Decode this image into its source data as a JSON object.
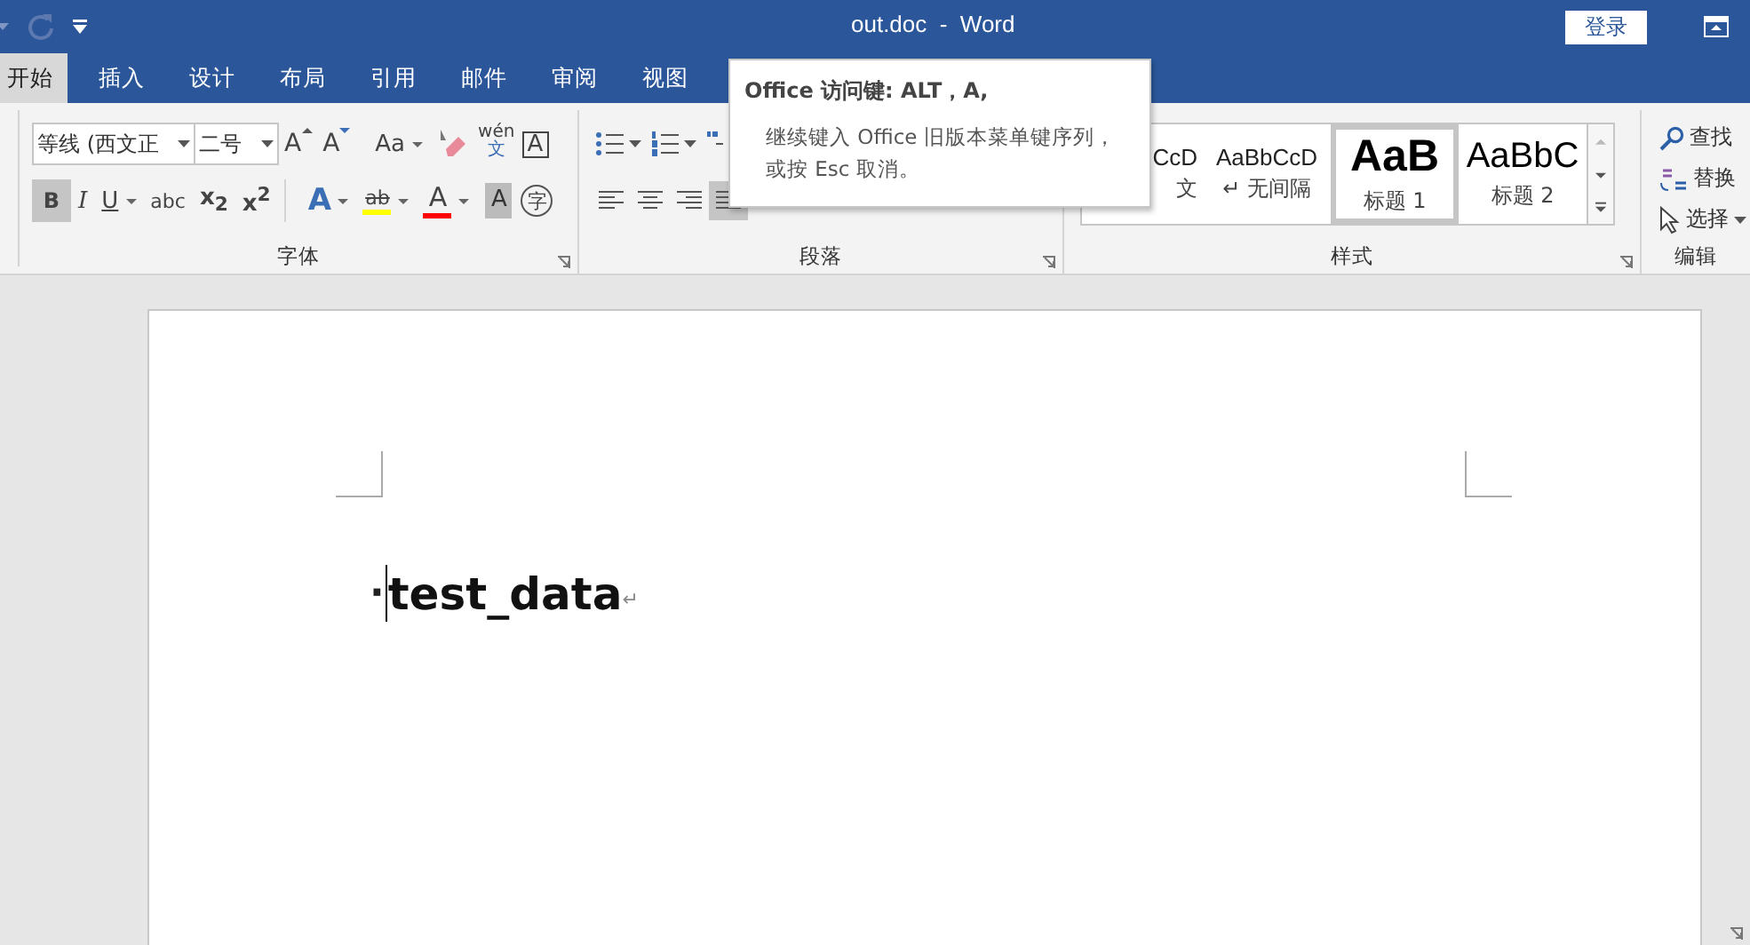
{
  "title_bar": {
    "redo": {
      "disabled": true
    },
    "title": "out.doc  -  Word",
    "login": "登录"
  },
  "tabs": [
    {
      "label": "开始",
      "selected": true
    },
    {
      "label": "插入",
      "selected": false
    },
    {
      "label": "设计",
      "selected": false
    },
    {
      "label": "布局",
      "selected": false
    },
    {
      "label": "引用",
      "selected": false
    },
    {
      "label": "邮件",
      "selected": false
    },
    {
      "label": "审阅",
      "selected": false
    },
    {
      "label": "视图",
      "selected": false
    }
  ],
  "font_group": {
    "label": "字体",
    "font": "等线 (西文正",
    "size": "二号",
    "row1": [
      {
        "kind": "grow",
        "text": "A"
      },
      {
        "kind": "shrink",
        "text": "A"
      },
      {
        "kind": "case",
        "text": "Aa"
      },
      {
        "kind": "eraser"
      },
      {
        "kind": "phonetic",
        "text": "wén",
        "sub": "文"
      },
      {
        "kind": "border",
        "text": "A"
      }
    ],
    "row2": [
      {
        "kind": "bold",
        "text": "B",
        "selected": true
      },
      {
        "kind": "italic",
        "text": "I",
        "selected": false
      },
      {
        "kind": "underline",
        "text": "U",
        "selected": false
      },
      {
        "kind": "strike",
        "text": "abc",
        "selected": false
      },
      {
        "kind": "script",
        "text": "x$_{2}$",
        "selected": false
      },
      {
        "kind": "script",
        "text": "x$^{2}$",
        "selected": false
      },
      {
        "kind": "effect",
        "text": "A",
        "selected": false
      },
      {
        "kind": "highlight",
        "text": "ab",
        "color": "#ffff00",
        "selected": false
      },
      {
        "kind": "fontcolor",
        "text": "A",
        "color": "#ff0000",
        "selected": false
      },
      {
        "kind": "shading",
        "text": "A",
        "selected": false
      },
      {
        "kind": "enclose",
        "text": "字",
        "selected": false
      }
    ]
  },
  "paragraph_group": {
    "label": "段落",
    "row1": [
      {
        "kind": "bullets"
      },
      {
        "kind": "numbering"
      },
      {
        "kind": "multilevel"
      }
    ],
    "row2": [
      {
        "kind": "left",
        "selected": false
      },
      {
        "kind": "center",
        "selected": false
      },
      {
        "kind": "right",
        "selected": false
      },
      {
        "kind": "justify",
        "selected": true
      }
    ]
  },
  "styles_group": {
    "label": "样式",
    "items": [
      {
        "kind": "body",
        "preview": "CcD",
        "label": "文",
        "selected": false
      },
      {
        "kind": "body",
        "preview": "AaBbCcD",
        "label": "↵ 无间隔",
        "selected": false
      },
      {
        "kind": "heading1",
        "preview": "AaB",
        "label": "标题 1",
        "selected": true
      },
      {
        "kind": "heading2",
        "preview": "AaBbC",
        "label": "标题 2",
        "selected": false
      }
    ]
  },
  "editing_group": {
    "label": "编辑",
    "items": [
      {
        "kind": "find",
        "label": "查找"
      },
      {
        "kind": "replace",
        "label": "替换"
      },
      {
        "kind": "select",
        "label": "选择"
      }
    ]
  },
  "tooltip": {
    "title": "Office 访问键: ALT，A,",
    "lines": [
      "继续键入 Office 旧版本菜单键序列，",
      "或按 Esc 取消。"
    ]
  },
  "document": {
    "lead_mark": "·",
    "text": "test_data",
    "end_mark": "↵"
  }
}
